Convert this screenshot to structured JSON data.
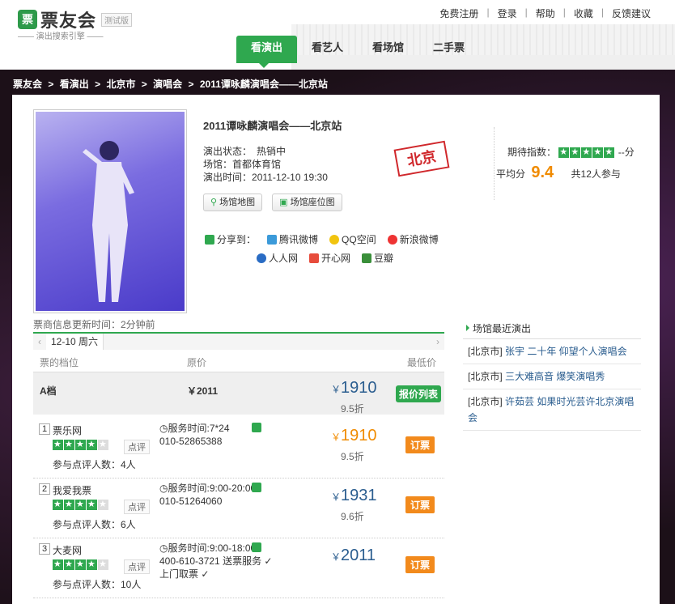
{
  "header": {
    "logo_text": "票友会",
    "beta": "测试版",
    "tagline": "—— 演出搜索引擎 ——",
    "top_links": [
      "免费注册",
      "登录",
      "帮助",
      "收藏",
      "反馈建议"
    ],
    "nav_tabs": [
      {
        "label": "看演出",
        "active": true
      },
      {
        "label": "看艺人",
        "active": false
      },
      {
        "label": "看场馆",
        "active": false
      },
      {
        "label": "二手票",
        "active": false
      }
    ]
  },
  "breadcrumb": [
    "票友会",
    ">",
    "看演出",
    ">",
    "北京市",
    ">",
    "演唱会",
    ">",
    "2011谭咏麟演唱会——北京站"
  ],
  "event": {
    "title": "2011谭咏麟演唱会——北京站",
    "status_label": "演出状态：",
    "status_value": "热销中",
    "venue_label": "场馆：",
    "venue_value": "首都体育馆",
    "time_label": "演出时间：",
    "time_value": "2011-12-10 19:30",
    "stamp": "北京",
    "map_btn": "场馆地图",
    "seat_btn": "场馆座位图"
  },
  "rating": {
    "expect_label": "期待指数：",
    "expect_suffix": "--分",
    "avg_label": "平均分",
    "avg_value": "9.4",
    "participants": "共12人参与",
    "stars": 5
  },
  "share": {
    "label": "分享到：",
    "row1": [
      "腾讯微博",
      "QQ空间",
      "新浪微博"
    ],
    "row2": [
      "人人网",
      "开心网",
      "豆瓣"
    ]
  },
  "update_time": "票商信息更新时间：2分钟前",
  "datebar": {
    "date": "12-10 周六"
  },
  "table": {
    "col_tier": "票的档位",
    "col_price": "原价",
    "col_low": "最低价",
    "tier": {
      "name": "A档",
      "price": "￥2011",
      "low": "1910",
      "discount": "9.5折",
      "btn": "报价列表"
    },
    "sellers": [
      {
        "rank": "1",
        "name": "票乐网",
        "stars": 4,
        "review": "点评",
        "count": "参与点评人数：4人",
        "service": "服务时间:7*24",
        "phone": "010-52865388",
        "extra": "",
        "pickup": "",
        "price": "1910",
        "price_color": "#f08b00",
        "discount": "9.5折",
        "btn": "订票"
      },
      {
        "rank": "2",
        "name": "我爱我票",
        "stars": 4,
        "review": "点评",
        "count": "参与点评人数：6人",
        "service": "服务时间:9:00-20:00",
        "phone": "010-51264060",
        "extra": "",
        "pickup": "",
        "price": "1931",
        "price_color": "#2a5d8f",
        "discount": "9.6折",
        "btn": "订票"
      },
      {
        "rank": "3",
        "name": "大麦网",
        "stars": 4,
        "review": "点评",
        "count": "参与点评人数：10人",
        "service": "服务时间:9:00-18:00",
        "phone": "400-610-3721",
        "extra": "送票服务 ✓",
        "pickup": "上门取票 ✓",
        "price": "2011",
        "price_color": "#2a5d8f",
        "discount": "",
        "btn": "订票"
      }
    ]
  },
  "sidebar": {
    "head": "场馆最近演出",
    "items": [
      {
        "city": "[北京市]",
        "title": "张宇 二十年 仰望个人演唱会"
      },
      {
        "city": "[北京市]",
        "title": "三大难高音 爆笑演唱秀"
      },
      {
        "city": "[北京市]",
        "title": "许茹芸 如果时光芸许北京演唱会"
      }
    ]
  }
}
